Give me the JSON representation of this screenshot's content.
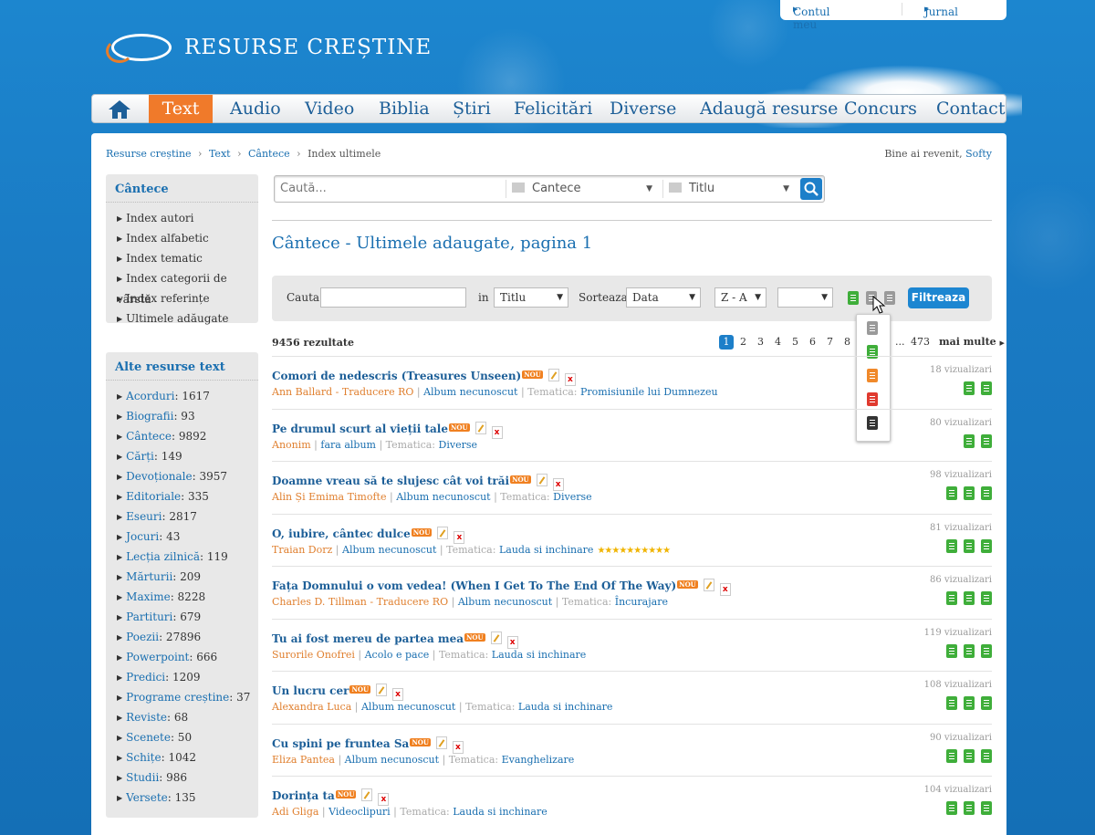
{
  "top_links": [
    "Contul meu",
    "Jurnal"
  ],
  "logo_text": "RESURSE CREȘTINE",
  "nav": [
    "Text",
    "Audio",
    "Video",
    "Biblia",
    "Știri",
    "Felicitări",
    "Diverse",
    "Adaugă resurse",
    "Concurs",
    "Contact"
  ],
  "breadcrumb": [
    "Resurse creștine",
    "Text",
    "Cântece",
    "Index ultimele"
  ],
  "welcome": {
    "text": "Bine ai revenit,",
    "user": "Softy"
  },
  "sidebar1": {
    "title": "Cântece",
    "items": [
      "Index autori",
      "Index alfabetic",
      "Index tematic",
      "Index categorii de vârstă",
      "Index referințe",
      "Ultimele adăugate"
    ]
  },
  "sidebar2": {
    "title": "Alte resurse text",
    "items": [
      {
        "name": "Acorduri",
        "count": ": 1617"
      },
      {
        "name": "Biografii",
        "count": ": 93"
      },
      {
        "name": "Cântece",
        "count": ": 9892"
      },
      {
        "name": "Cărți",
        "count": ": 149"
      },
      {
        "name": "Devoționale",
        "count": ": 3957"
      },
      {
        "name": "Editoriale",
        "count": ": 335"
      },
      {
        "name": "Eseuri",
        "count": ": 2817"
      },
      {
        "name": "Jocuri",
        "count": ": 43"
      },
      {
        "name": "Lecția zilnică",
        "count": ": 119"
      },
      {
        "name": "Mărturii",
        "count": ": 209"
      },
      {
        "name": "Maxime",
        "count": ": 8228"
      },
      {
        "name": "Partituri",
        "count": ": 679"
      },
      {
        "name": "Poezii",
        "count": ": 27896"
      },
      {
        "name": "Powerpoint",
        "count": ": 666"
      },
      {
        "name": "Predici",
        "count": ": 1209"
      },
      {
        "name": "Programe creștine",
        "count": ": 37"
      },
      {
        "name": "Reviste",
        "count": ": 68"
      },
      {
        "name": "Scenete",
        "count": ": 50"
      },
      {
        "name": "Schițe",
        "count": ": 1042"
      },
      {
        "name": "Studii",
        "count": ": 986"
      },
      {
        "name": "Versete",
        "count": ": 135"
      }
    ]
  },
  "search": {
    "placeholder": "Caută...",
    "category": "Cantece",
    "field": "Titlu"
  },
  "page_title": "Cântece - Ultimele adaugate, pagina 1",
  "filter": {
    "cauta_label": "Cauta",
    "in_label": "in",
    "in_value": "Titlu",
    "sort_label": "Sorteaza",
    "sort_value": "Data",
    "order_value": "Z - A",
    "extra_value": "",
    "button": "Filtreaza"
  },
  "results_count": "9456 rezultate",
  "pagination": {
    "pages": [
      "1",
      "2",
      "3",
      "4",
      "5",
      "6",
      "7",
      "8"
    ],
    "ellipsis": "...",
    "last": "473",
    "more": "mai multe"
  },
  "nou_label": "NOU",
  "items": [
    {
      "title": "Comori de nedescris (Treasures Unseen)",
      "author": "Ann Ballard - Traducere RO",
      "album": "Album necunoscut",
      "tematica_label": "Tematica:",
      "tematica": "Promisiunile lui Dumnezeu",
      "views": "18 vizualizari",
      "icons": [
        "g",
        "g"
      ]
    },
    {
      "title": "Pe drumul scurt al vieții tale",
      "author": "Anonim",
      "album": "fara album",
      "tematica_label": "Tematica:",
      "tematica": "Diverse",
      "views": "80 vizualizari",
      "icons": [
        "g",
        "g"
      ]
    },
    {
      "title": "Doamne vreau să te slujesc cât voi trăi",
      "author": "Alin Și Emima Timofte",
      "album": "Album necunoscut",
      "tematica_label": "Tematica:",
      "tematica": "Diverse",
      "views": "98 vizualizari",
      "icons": [
        "g",
        "g",
        "g"
      ]
    },
    {
      "title": "O, iubire, cântec dulce",
      "author": "Traian Dorz",
      "album": "Album necunoscut",
      "tematica_label": "Tematica:",
      "tematica": "Lauda si inchinare",
      "views": "81 vizualizari",
      "icons": [
        "g",
        "g",
        "g"
      ],
      "stars": "★★★★★★★★★★"
    },
    {
      "title": "Fața Domnului o vom vedea! (When I Get To The End Of The Way)",
      "author": "Charles D. Tillman - Traducere RO",
      "album": "Album necunoscut",
      "tematica_label": "Tematica:",
      "tematica": "Încurajare",
      "views": "86 vizualizari",
      "icons": [
        "g",
        "g",
        "g"
      ]
    },
    {
      "title": "Tu ai fost mereu de partea mea",
      "author": "Surorile Onofrei",
      "album": "Acolo e pace",
      "tematica_label": "Tematica:",
      "tematica": "Lauda si inchinare",
      "views": "119 vizualizari",
      "icons": [
        "g",
        "g",
        "g"
      ]
    },
    {
      "title": "Un lucru cer",
      "author": "Alexandra Luca",
      "album": "Album necunoscut",
      "tematica_label": "Tematica:",
      "tematica": "Lauda si inchinare",
      "views": "108 vizualizari",
      "icons": [
        "g",
        "g",
        "g"
      ]
    },
    {
      "title": "Cu spini pe fruntea Sa",
      "author": "Eliza Pantea",
      "album": "Album necunoscut",
      "tematica_label": "Tematica:",
      "tematica": "Evanghelizare",
      "views": "90 vizualizari",
      "icons": [
        "g",
        "g",
        "g"
      ]
    },
    {
      "title": "Dorința ta",
      "author": "Adi Gliga",
      "album": "Videoclipuri",
      "tematica_label": "Tematica:",
      "tematica": "Lauda si inchinare",
      "views": "104 vizualizari",
      "icons": [
        "g",
        "g",
        "g"
      ]
    }
  ],
  "colors": {
    "brand_blue": "#1a78c0",
    "accent_orange": "#f07a2a",
    "link": "#1a6fb0"
  }
}
